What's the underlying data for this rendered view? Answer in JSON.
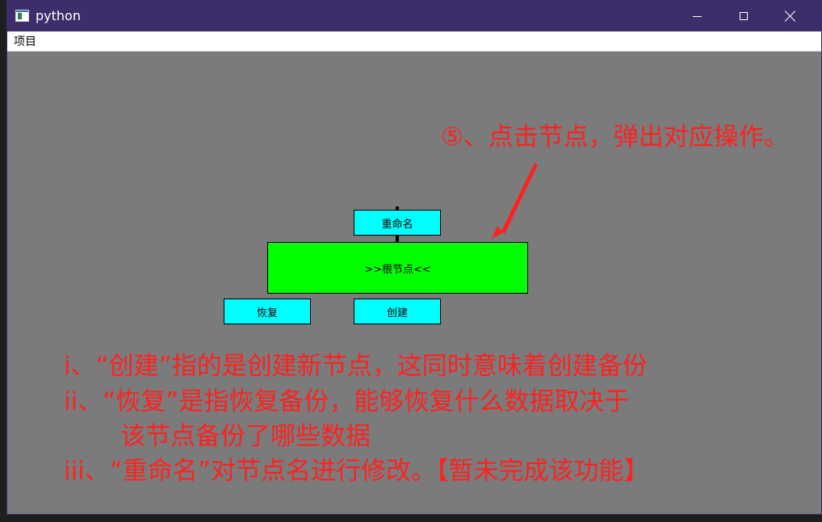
{
  "window": {
    "title": "python",
    "title_bar_color": "#3d2d6b",
    "canvas_color": "#7b7b7b"
  },
  "menubar": {
    "items": [
      {
        "label": "项目"
      }
    ]
  },
  "tree": {
    "rename_button": "重命名",
    "root_node": ">>根节点<<",
    "restore_button": "恢复",
    "create_button": "创建",
    "button_color": "#00ffff",
    "root_color": "#00ff00"
  },
  "annotations": {
    "step5": "⑤、点击节点，弹出对应操作。",
    "line1": "i、“创建”指的是创建新节点，这同时意味着创建备份",
    "line2": "ii、“恢复”是指恢复备份，能够恢复什么数据取决于",
    "line3": "该节点备份了哪些数据",
    "line4": "iii、“重命名”对节点名进行修改。【暂未完成该功能】",
    "color": "#ff2020"
  }
}
